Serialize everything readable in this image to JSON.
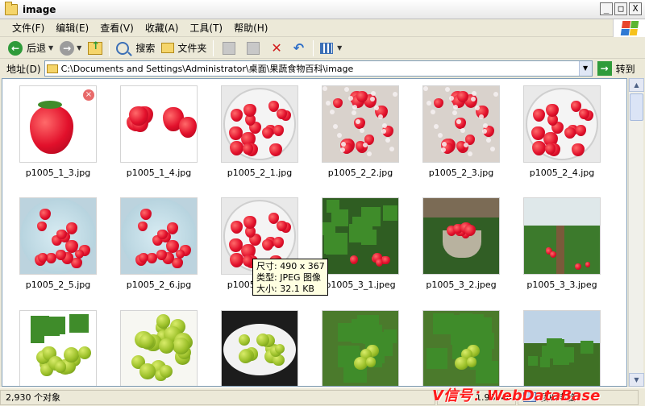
{
  "window": {
    "title": "image",
    "buttons": {
      "minimize": "_",
      "maximize": "□",
      "close": "X"
    }
  },
  "menu": [
    "文件(F)",
    "编辑(E)",
    "查看(V)",
    "收藏(A)",
    "工具(T)",
    "帮助(H)"
  ],
  "toolbar": {
    "back": "后退",
    "search": "搜索",
    "folders": "文件夹"
  },
  "address": {
    "label": "地址(D)",
    "path": "C:\\Documents and Settings\\Administrator\\桌面\\果蔬食物百科\\image",
    "go": "转到"
  },
  "files": [
    {
      "name": "p1005_1_3.jpg",
      "kind": "single-strawberry"
    },
    {
      "name": "p1005_1_4.jpg",
      "kind": "cut-strawberries"
    },
    {
      "name": "p1005_2_1.jpg",
      "kind": "bowl-strawberries"
    },
    {
      "name": "p1005_2_2.jpg",
      "kind": "salt-strawberries"
    },
    {
      "name": "p1005_2_3.jpg",
      "kind": "salt-strawberries"
    },
    {
      "name": "p1005_2_4.jpg",
      "kind": "bowl-strawberries"
    },
    {
      "name": "p1005_2_5.jpg",
      "kind": "water-strawberries"
    },
    {
      "name": "p1005_2_6.jpg",
      "kind": "water-strawberries"
    },
    {
      "name": "p1005_2_7.jpg",
      "kind": "bowl-strawberries"
    },
    {
      "name": "p1005_3_1.jpeg",
      "kind": "field"
    },
    {
      "name": "p1005_3_2.jpeg",
      "kind": "basket-field"
    },
    {
      "name": "p1005_3_3.jpeg",
      "kind": "greenhouse"
    },
    {
      "name": "",
      "kind": "olives-leaves"
    },
    {
      "name": "",
      "kind": "olives-pile"
    },
    {
      "name": "",
      "kind": "olives-bowl"
    },
    {
      "name": "",
      "kind": "olive-tree"
    },
    {
      "name": "",
      "kind": "olive-tree"
    },
    {
      "name": "",
      "kind": "orchard"
    }
  ],
  "tooltip": {
    "dimensions": "尺寸: 490 x 367",
    "type": "类型: JPEG 图像",
    "size": "大小: 32.1 KB"
  },
  "status": {
    "count": "2,930 个对象",
    "size": "1.96 MB",
    "location": "我的电脑"
  },
  "watermark": "V信号：WebDataBase"
}
